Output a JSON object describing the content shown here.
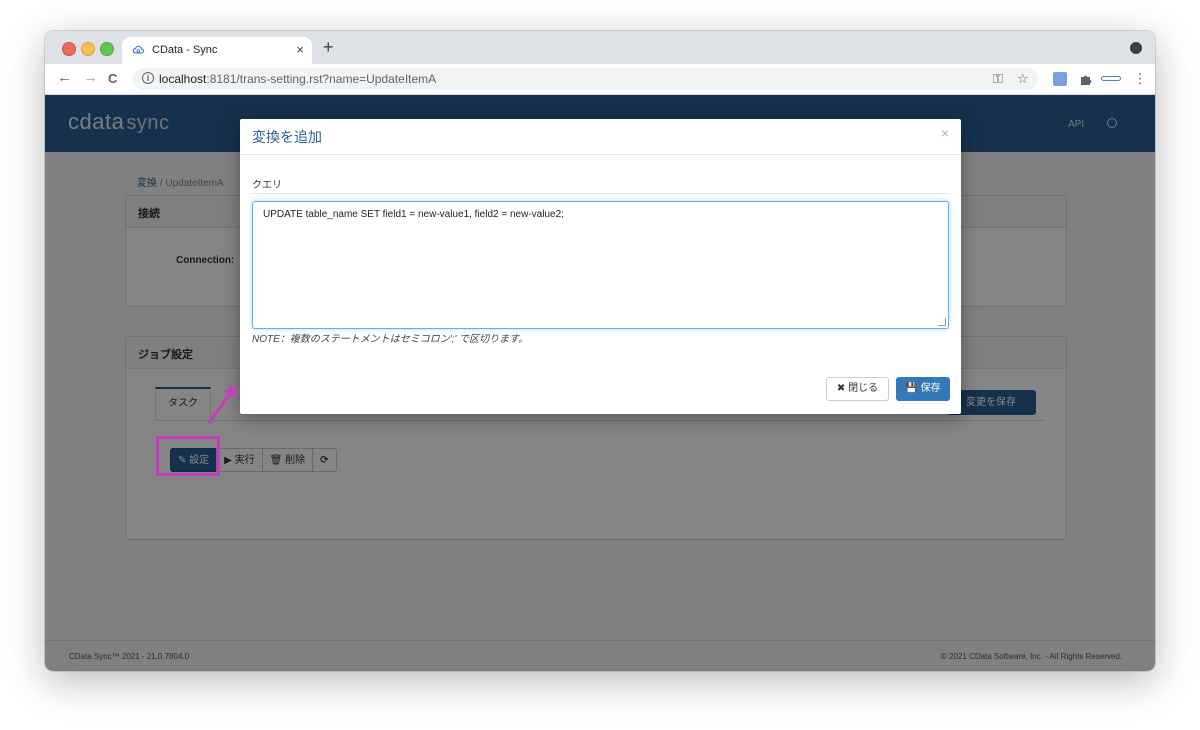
{
  "browser": {
    "tab_title": "CData - Sync",
    "tab_close": "×",
    "new_tab": "+",
    "back": "←",
    "forward": "→",
    "reload": "C",
    "info": "i",
    "url_host": "localhost",
    "url_rest": ":8181/trans-setting.rst?name=UpdateItemA",
    "key_icon": "⚿",
    "star_icon": "☆",
    "menu_icon": "⋮"
  },
  "header": {
    "logo": "cdata",
    "logo_suffix": "sync",
    "api_label": "API"
  },
  "breadcrumb": {
    "root": "変換",
    "separator": " / ",
    "current": "UpdateItemA"
  },
  "connection_panel": {
    "title": "接続",
    "connection_label": "Connection:"
  },
  "job_panel": {
    "title": "ジョブ設定",
    "tab_task": "タスク",
    "save_changes": "変更を保存",
    "btn_settings": "設定",
    "btn_run": "実行",
    "btn_delete": "削除"
  },
  "modal": {
    "title": "変換を追加",
    "close_x": "×",
    "query_label": "クエリ",
    "query_text": "UPDATE table_name SET field1 = new-value1, field2 = new-value2;",
    "note": "NOTE：複数のステートメントはセミコロン';' で区切ります。",
    "close_button": "閉じる",
    "save_button": "保存"
  },
  "footer": {
    "left": "CData Sync™ 2021 - 21.0.7804.0",
    "right": "© 2021 CData Software, Inc. - All Rights Reserved."
  },
  "colors": {
    "brand": "#2b5f96",
    "primary_button": "#3479b7",
    "annotation": "#c63cbf"
  }
}
